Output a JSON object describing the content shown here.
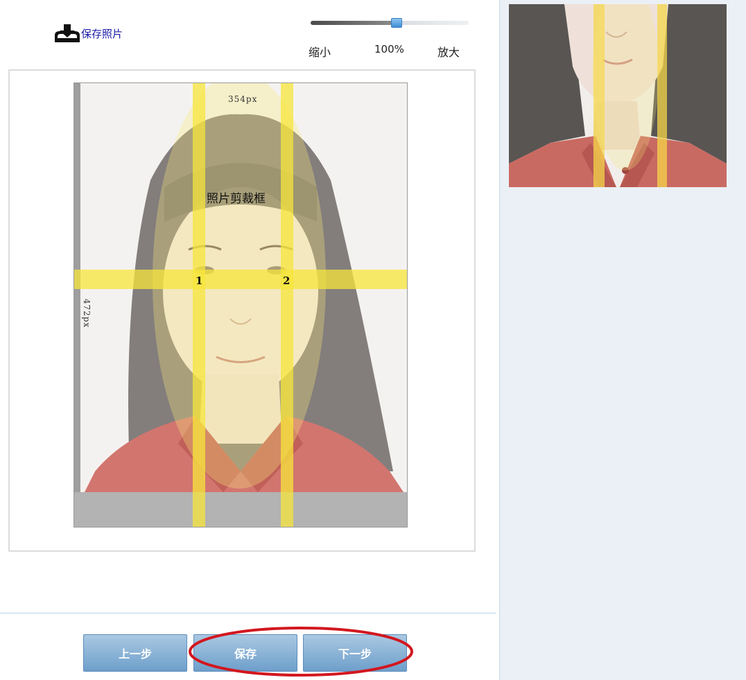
{
  "toolbar": {
    "save_photo_label": "保存照片",
    "zoom_out_label": "缩小",
    "zoom_percent": "100%",
    "zoom_in_label": "放大",
    "zoom_level_fraction": 0.53
  },
  "editor": {
    "width_label": "354px",
    "height_label": "472px",
    "crop_frame_label": "照片剪裁框",
    "guide_markers": [
      "1",
      "2"
    ],
    "guide_color": "#f7e53b"
  },
  "buttons": {
    "prev_label": "上一步",
    "save_label": "保存",
    "next_label": "下一步"
  },
  "colors": {
    "link": "#1a1aa8",
    "button": "#7aa8d2",
    "highlight": "#d2171f",
    "right_panel": "#eaf0f5"
  }
}
